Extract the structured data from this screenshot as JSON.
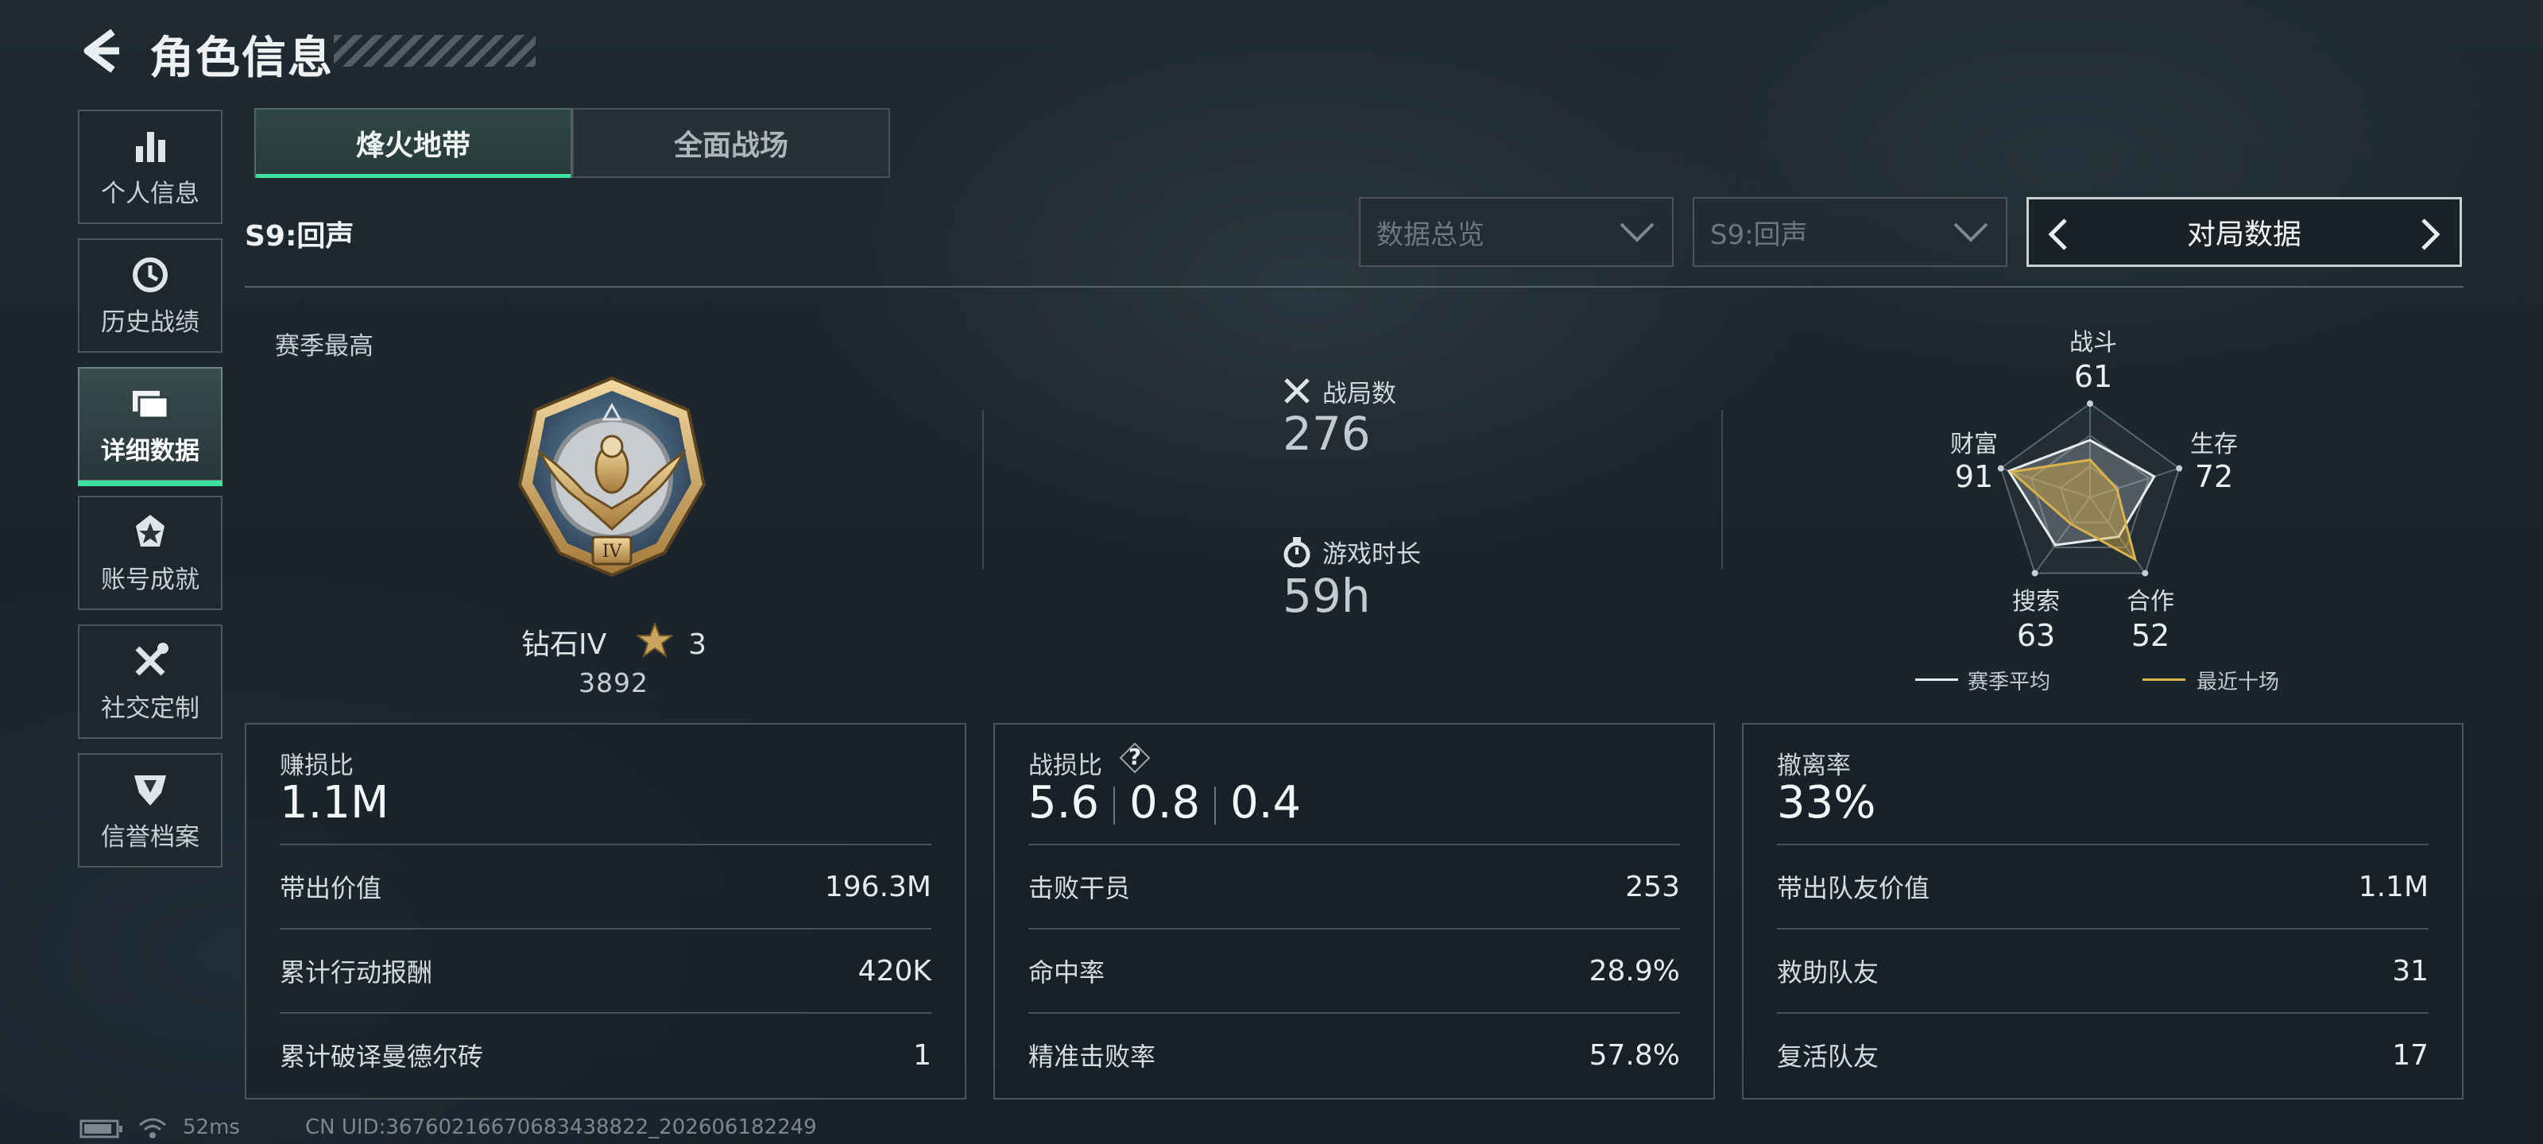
{
  "header": {
    "title": "角色信息"
  },
  "sidebar": {
    "items": [
      {
        "label": "个人信息",
        "icon": "bar-chart-icon"
      },
      {
        "label": "历史战绩",
        "icon": "clock-icon"
      },
      {
        "label": "详细数据",
        "icon": "folder-icon",
        "active": true
      },
      {
        "label": "账号成就",
        "icon": "medal-icon"
      },
      {
        "label": "社交定制",
        "icon": "tools-icon"
      },
      {
        "label": "信誉档案",
        "icon": "shield-icon"
      }
    ]
  },
  "mode_tabs": [
    {
      "label": "烽火地带",
      "active": true
    },
    {
      "label": "全面战场",
      "active": false
    }
  ],
  "season": {
    "label": "S9:回声"
  },
  "filters": {
    "view_dropdown": "数据总览",
    "season_dropdown": "S9:回声",
    "pager_label": "对局数据"
  },
  "rank": {
    "section_label": "赛季最高",
    "name": "钻石IV",
    "stars": "3",
    "score": "3892"
  },
  "summary": {
    "matches_label": "战局数",
    "matches_value": "276",
    "playtime_label": "游戏时长",
    "playtime_value": "59h"
  },
  "radar": {
    "axes": [
      {
        "label": "战斗",
        "value": "61"
      },
      {
        "label": "生存",
        "value": "72"
      },
      {
        "label": "合作",
        "value": "52"
      },
      {
        "label": "搜索",
        "value": "63"
      },
      {
        "label": "财富",
        "value": "91"
      }
    ],
    "season_avg": [
      61,
      72,
      52,
      63,
      91
    ],
    "recent_ten": [
      40,
      30,
      82,
      35,
      88
    ],
    "legend": {
      "season_avg": "赛季平均",
      "recent_ten": "最近十场"
    },
    "colors": {
      "season_avg": "#e8ecee",
      "recent_ten": "#d9b24a"
    }
  },
  "cards": {
    "profit": {
      "title": "赚损比",
      "big": "1.1M",
      "rows": [
        {
          "label": "带出价值",
          "value": "196.3M"
        },
        {
          "label": "累计行动报酬",
          "value": "420K"
        },
        {
          "label": "累计破译曼德尔砖",
          "value": "1"
        }
      ]
    },
    "combat": {
      "title": "战损比",
      "help_icon": "?",
      "big_parts": [
        "5.6",
        "0.8",
        "0.4"
      ],
      "rows": [
        {
          "label": "击败干员",
          "value": "253"
        },
        {
          "label": "命中率",
          "value": "28.9%"
        },
        {
          "label": "精准击败率",
          "value": "57.8%"
        }
      ]
    },
    "extract": {
      "title": "撤离率",
      "big": "33%",
      "rows": [
        {
          "label": "带出队友价值",
          "value": "1.1M"
        },
        {
          "label": "救助队友",
          "value": "31"
        },
        {
          "label": "复活队友",
          "value": "17"
        }
      ]
    }
  },
  "footer": {
    "ping": "52ms",
    "uid": "CN UID:36760216670683438822_202606182249"
  }
}
